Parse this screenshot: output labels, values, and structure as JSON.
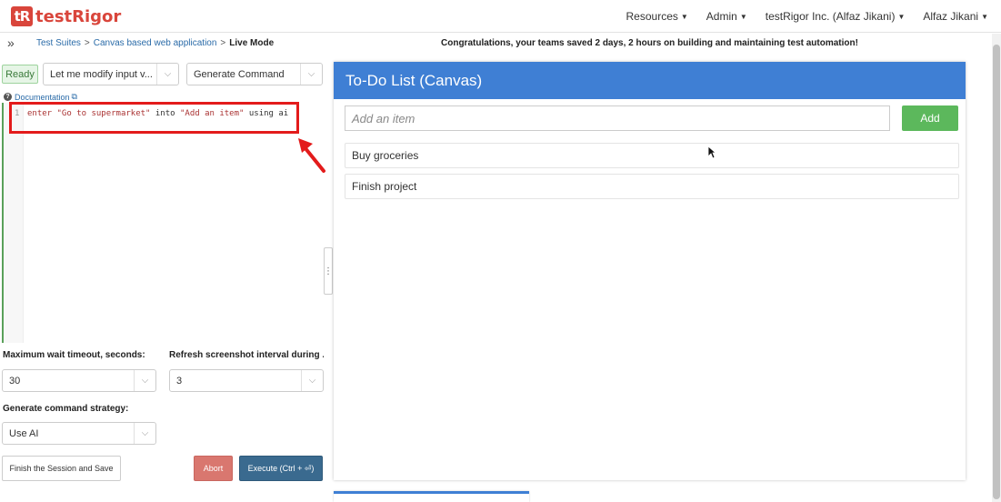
{
  "brand": {
    "mark": "tR",
    "name": "testRigor"
  },
  "topnav": [
    {
      "label": "Resources"
    },
    {
      "label": "Admin"
    },
    {
      "label": "testRigor Inc. (Alfaz Jikani)"
    },
    {
      "label": "Alfaz Jikani"
    }
  ],
  "breadcrumb": {
    "toggle": "»",
    "items": [
      "Test Suites",
      "Canvas based web application"
    ],
    "separator": ">",
    "current": "Live Mode"
  },
  "congrats_text": "Congratulations, your teams saved 2 days, 2 hours on building and maintaining test automation!",
  "left_panel": {
    "status": "Ready",
    "mode_select": "Let me modify input v...",
    "generate_select": "Generate Command",
    "documentation_label": "Documentation",
    "editor": {
      "line_number": "1",
      "code": {
        "kw1": "enter ",
        "str1": "\"Go to supermarket\"",
        "mid": " into ",
        "str2": "\"Add an item\"",
        "tail": " using ai"
      }
    },
    "max_wait_label": "Maximum wait timeout, seconds:",
    "max_wait_value": "30",
    "refresh_label": "Refresh screenshot interval during ...",
    "refresh_value": "3",
    "strategy_label": "Generate command strategy:",
    "strategy_value": "Use AI",
    "finish_button": "Finish the Session and Save",
    "abort_button": "Abort",
    "execute_button": "Execute (Ctrl + ⏎)"
  },
  "canvas_app": {
    "title": "To-Do List (Canvas)",
    "input_placeholder": "Add an item",
    "add_button": "Add",
    "items": [
      "Buy groceries",
      "Finish project"
    ]
  },
  "colors": {
    "brand_red": "#d9453b",
    "header_blue": "#3f7fd4",
    "add_green": "#5cb85c",
    "annotation_red": "#e31b1b"
  }
}
